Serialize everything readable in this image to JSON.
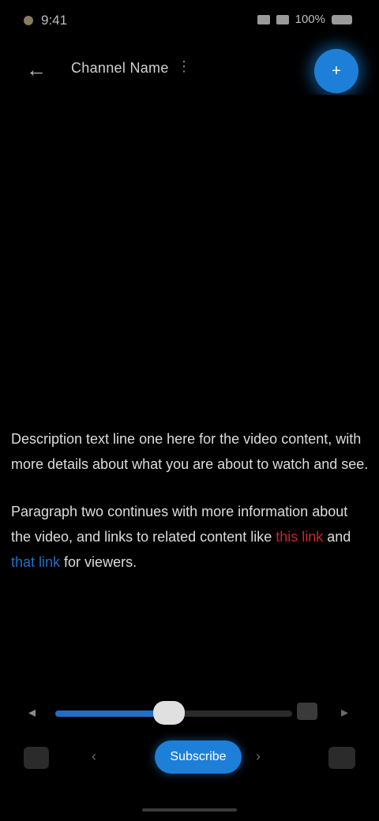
{
  "status_bar": {
    "time": "9:41",
    "battery": "100%"
  },
  "header": {
    "back_icon": "arrow-left-icon",
    "channel_name": "Channel Name",
    "menu_glyph": "⋮",
    "fab_icon": "plus-icon",
    "fab_glyph": "+",
    "accent_color": "#1e7fd8"
  },
  "description": {
    "paragraph_1": "Description text line one here for the video content, with more details about what you are about to watch and see.",
    "paragraph_2_start": "Paragraph two continues with more information about the video, and links to related content like ",
    "paragraph_2_red": "this link",
    "paragraph_2_mid": " and ",
    "paragraph_2_blue": "that link",
    "paragraph_2_end": " for viewers.",
    "red_color": "#c62828",
    "blue_color": "#1e6fc8"
  },
  "controls": {
    "seek_progress": 0.48,
    "left_icon": "rewind-icon",
    "left_glyph": "◂",
    "far_right_glyph": "▸",
    "mid_glyph": "‹",
    "after_glyph": "›",
    "pill_label": "Subscribe",
    "pill_color": "#1e7fd8"
  }
}
